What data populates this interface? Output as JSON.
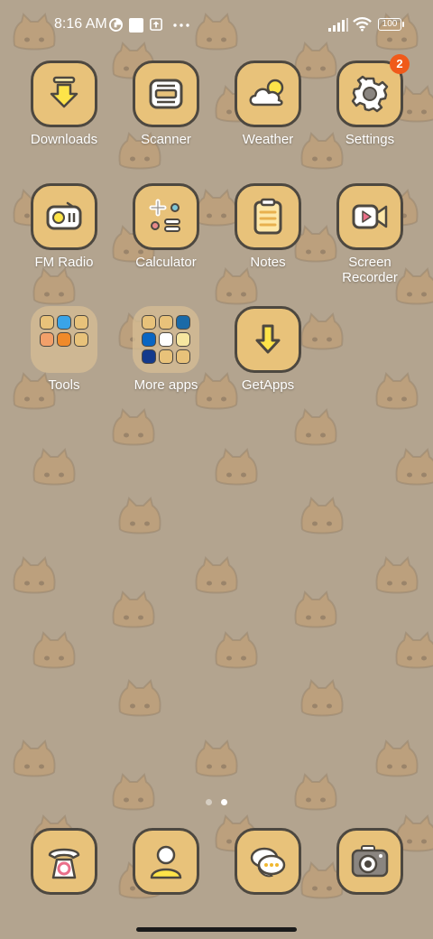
{
  "status_bar": {
    "time": "8:16 AM",
    "battery_level": "100",
    "notification_icons": [
      "data-saver-icon",
      "square-notification-icon",
      "upload-icon",
      "more-dots-icon"
    ],
    "right_icons": [
      "signal-icon",
      "wifi-icon",
      "battery-icon"
    ]
  },
  "apps": [
    {
      "label": "Downloads",
      "icon": "download-icon"
    },
    {
      "label": "Scanner",
      "icon": "scanner-icon"
    },
    {
      "label": "Weather",
      "icon": "weather-icon"
    },
    {
      "label": "Settings",
      "icon": "gear-icon",
      "badge": "2"
    },
    {
      "label": "FM Radio",
      "icon": "radio-icon"
    },
    {
      "label": "Calculator",
      "icon": "calculator-icon"
    },
    {
      "label": "Notes",
      "icon": "notes-icon"
    },
    {
      "label": "Screen Recorder",
      "icon": "screen-recorder-icon"
    },
    {
      "label": "Tools",
      "icon": "folder-icon"
    },
    {
      "label": "More apps",
      "icon": "folder-icon"
    },
    {
      "label": "GetApps",
      "icon": "getapps-icon"
    }
  ],
  "page_indicator": {
    "total": 2,
    "current": 2
  },
  "dock": [
    {
      "icon": "phone-icon"
    },
    {
      "icon": "contacts-icon"
    },
    {
      "icon": "messages-icon"
    },
    {
      "icon": "camera-icon"
    }
  ],
  "colors": {
    "wallpaper": "#b3a48f",
    "tile": "#e8c27a",
    "tile_border": "#4d4840",
    "badge": "#f05a1a",
    "label": "#ffffff"
  }
}
